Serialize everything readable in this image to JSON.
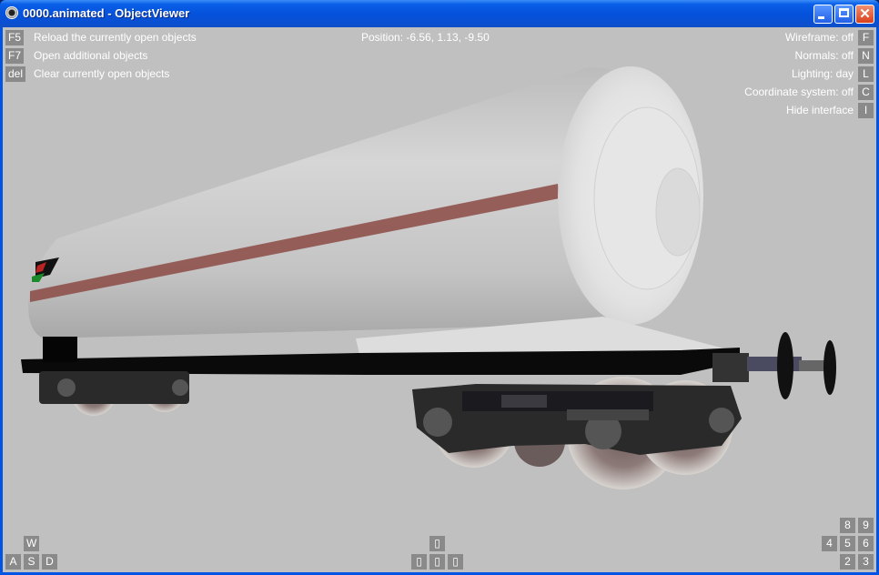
{
  "window": {
    "title": "0000.animated - ObjectViewer"
  },
  "left_menu": [
    {
      "key": "F5",
      "label": "Reload the currently open objects"
    },
    {
      "key": "F7",
      "label": "Open additional objects"
    },
    {
      "key": "del",
      "label": "Clear currently open objects"
    }
  ],
  "position": "Position: -6.56, 1.13, -9.50",
  "right_menu": [
    {
      "label": "Wireframe: off",
      "key": "F"
    },
    {
      "label": "Normals: off",
      "key": "N"
    },
    {
      "label": "Lighting: day",
      "key": "L"
    },
    {
      "label": "Coordinate system: off",
      "key": "C"
    },
    {
      "label": "Hide interface",
      "key": "I"
    }
  ],
  "move_keys": {
    "w": "W",
    "a": "A",
    "s": "S",
    "d": "D"
  },
  "arrow_keys": {
    "up": "▯",
    "left": "▯",
    "down": "▯",
    "right": "▯"
  },
  "numpad": {
    "k8": "8",
    "k9": "9",
    "k4": "4",
    "k5": "5",
    "k6": "6",
    "k2": "2",
    "k3": "3"
  },
  "colors": {
    "viewport_bg": "#c0c0c0",
    "key_bg": "#8a8a8a",
    "tank": "#c9c9c9",
    "stripe": "#8c4a44"
  }
}
